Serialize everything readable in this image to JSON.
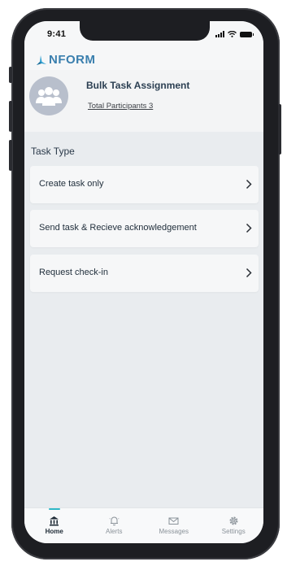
{
  "status_bar": {
    "time": "9:41"
  },
  "app": {
    "logo_text": "NFORM"
  },
  "profile": {
    "title": "Bulk Task Assignment",
    "participants": "Total Participants 3"
  },
  "section_title": "Task Type",
  "task_types": [
    {
      "label": "Create task only"
    },
    {
      "label": "Send task & Recieve acknowledgement"
    },
    {
      "label": "Request check-in"
    }
  ],
  "tabs": [
    {
      "label": "Home",
      "icon": "bank-icon",
      "active": true
    },
    {
      "label": "Alerts",
      "icon": "bell-icon",
      "active": false
    },
    {
      "label": "Messages",
      "icon": "mail-icon",
      "active": false
    },
    {
      "label": "Settings",
      "icon": "gear-icon",
      "active": false
    }
  ],
  "colors": {
    "accent": "#2fb8c7",
    "brand": "#3a7fae"
  }
}
